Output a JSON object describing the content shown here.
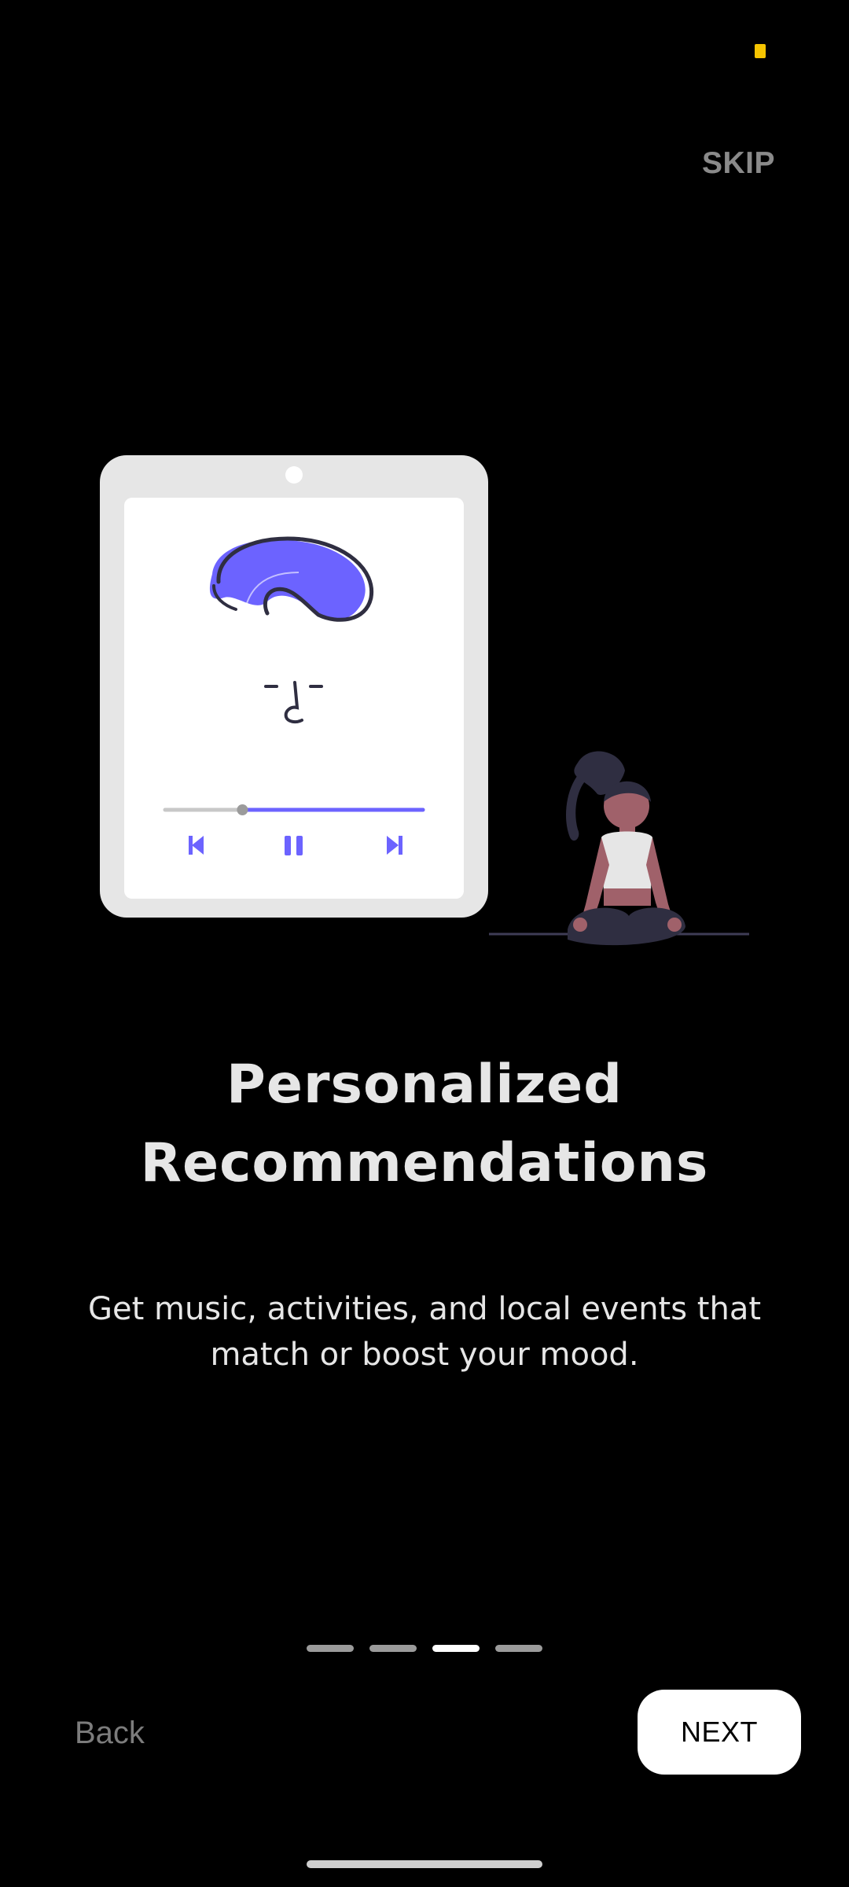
{
  "header": {
    "skip_label": "SKIP"
  },
  "onboarding": {
    "title_line1": "Personalized",
    "title_line2": "Recommendations",
    "description_line1": "Get music, activities, and local events that",
    "description_line2": "match or boost your mood.",
    "pages_total": 4,
    "current_page": 3
  },
  "footer": {
    "back_label": "Back",
    "next_label": "NEXT"
  },
  "player": {
    "progress": 0.3
  },
  "colors": {
    "accent": "#6c63ff",
    "background": "#000000",
    "muted": "#8a8a8a"
  }
}
